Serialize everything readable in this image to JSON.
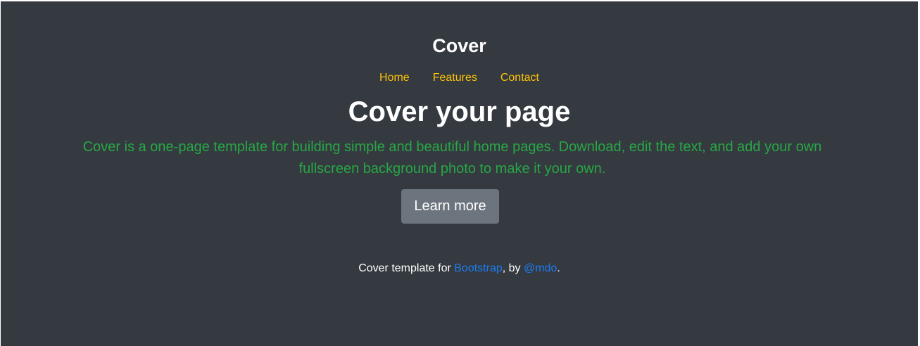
{
  "header": {
    "brand": "Cover",
    "nav": [
      {
        "label": "Home"
      },
      {
        "label": "Features"
      },
      {
        "label": "Contact"
      }
    ]
  },
  "main": {
    "title": "Cover your page",
    "lead": "Cover is a one-page template for building simple and beautiful home pages. Download, edit the text, and add your own fullscreen background photo to make it your own.",
    "button_label": "Learn more"
  },
  "footer": {
    "prefix": "Cover template for ",
    "link1": "Bootstrap",
    "middle": ", by ",
    "link2": "@mdo",
    "suffix": "."
  },
  "colors": {
    "background": "#343a40",
    "nav_link": "#ffc107",
    "lead": "#28a745",
    "button": "#6c757d",
    "footer_link": "#1e7bf0"
  }
}
